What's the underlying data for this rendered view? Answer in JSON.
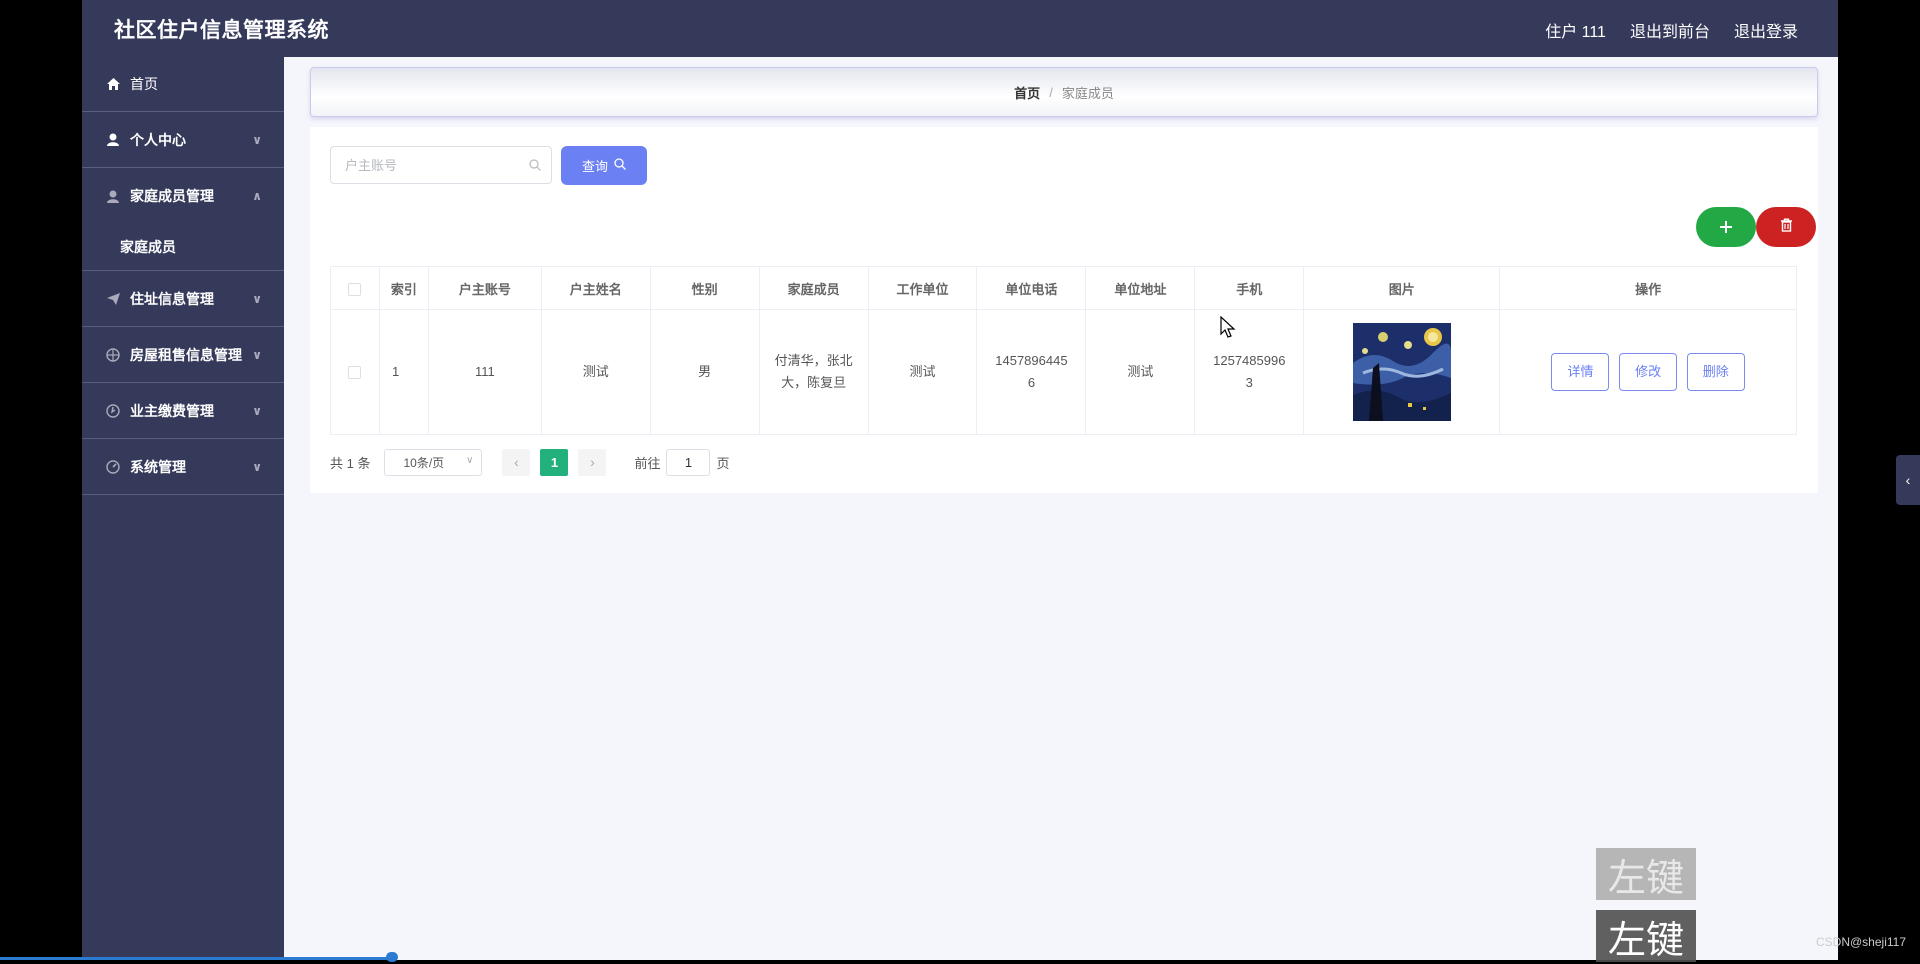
{
  "app_title": "社区住户信息管理系统",
  "header": {
    "user_label": "住户 111",
    "back_front": "退出到前台",
    "logout": "退出登录"
  },
  "sidebar": {
    "items": [
      {
        "label": "首页",
        "icon": "home-icon"
      },
      {
        "label": "个人中心",
        "icon": "user-icon"
      },
      {
        "label": "家庭成员管理",
        "icon": "user-icon"
      },
      {
        "label": "家庭成员",
        "icon": ""
      },
      {
        "label": "住址信息管理",
        "icon": "send-icon"
      },
      {
        "label": "房屋租售信息管理",
        "icon": "compass-icon"
      },
      {
        "label": "业主缴费管理",
        "icon": "clock-icon"
      },
      {
        "label": "系统管理",
        "icon": "gauge-icon"
      }
    ]
  },
  "breadcrumb": {
    "home": "首页",
    "separator": "/",
    "current": "家庭成员"
  },
  "search": {
    "placeholder": "户主账号",
    "query_label": "查询"
  },
  "table": {
    "headers": [
      "索引",
      "户主账号",
      "户主姓名",
      "性别",
      "家庭成员",
      "工作单位",
      "单位电话",
      "单位地址",
      "手机",
      "图片",
      "操作"
    ],
    "rows": [
      {
        "index": "1",
        "account": "111",
        "name": "测试",
        "gender": "男",
        "members_line1": "付清华，张北",
        "members_line2": "大，陈复旦",
        "work_unit": "测试",
        "unit_phone_line1": "1457896445",
        "unit_phone_line2": "6",
        "unit_address": "测试",
        "mobile_line1": "1257485996",
        "mobile_line2": "3"
      }
    ],
    "actions": {
      "detail": "详情",
      "edit": "修改",
      "delete": "删除"
    }
  },
  "pagination": {
    "total": "共 1 条",
    "page_size": "10条/页",
    "current_page": "1",
    "goto_prefix": "前往",
    "goto_value": "1",
    "goto_suffix": "页"
  },
  "overlay": {
    "key1": "左键",
    "key2": "左键",
    "watermark": "CSDN@sheji117"
  },
  "colors": {
    "nav_bg": "#353a5b",
    "primary": "#6a80f3",
    "add": "#22a844",
    "delete": "#cc2222",
    "page_active": "#22b07d"
  }
}
